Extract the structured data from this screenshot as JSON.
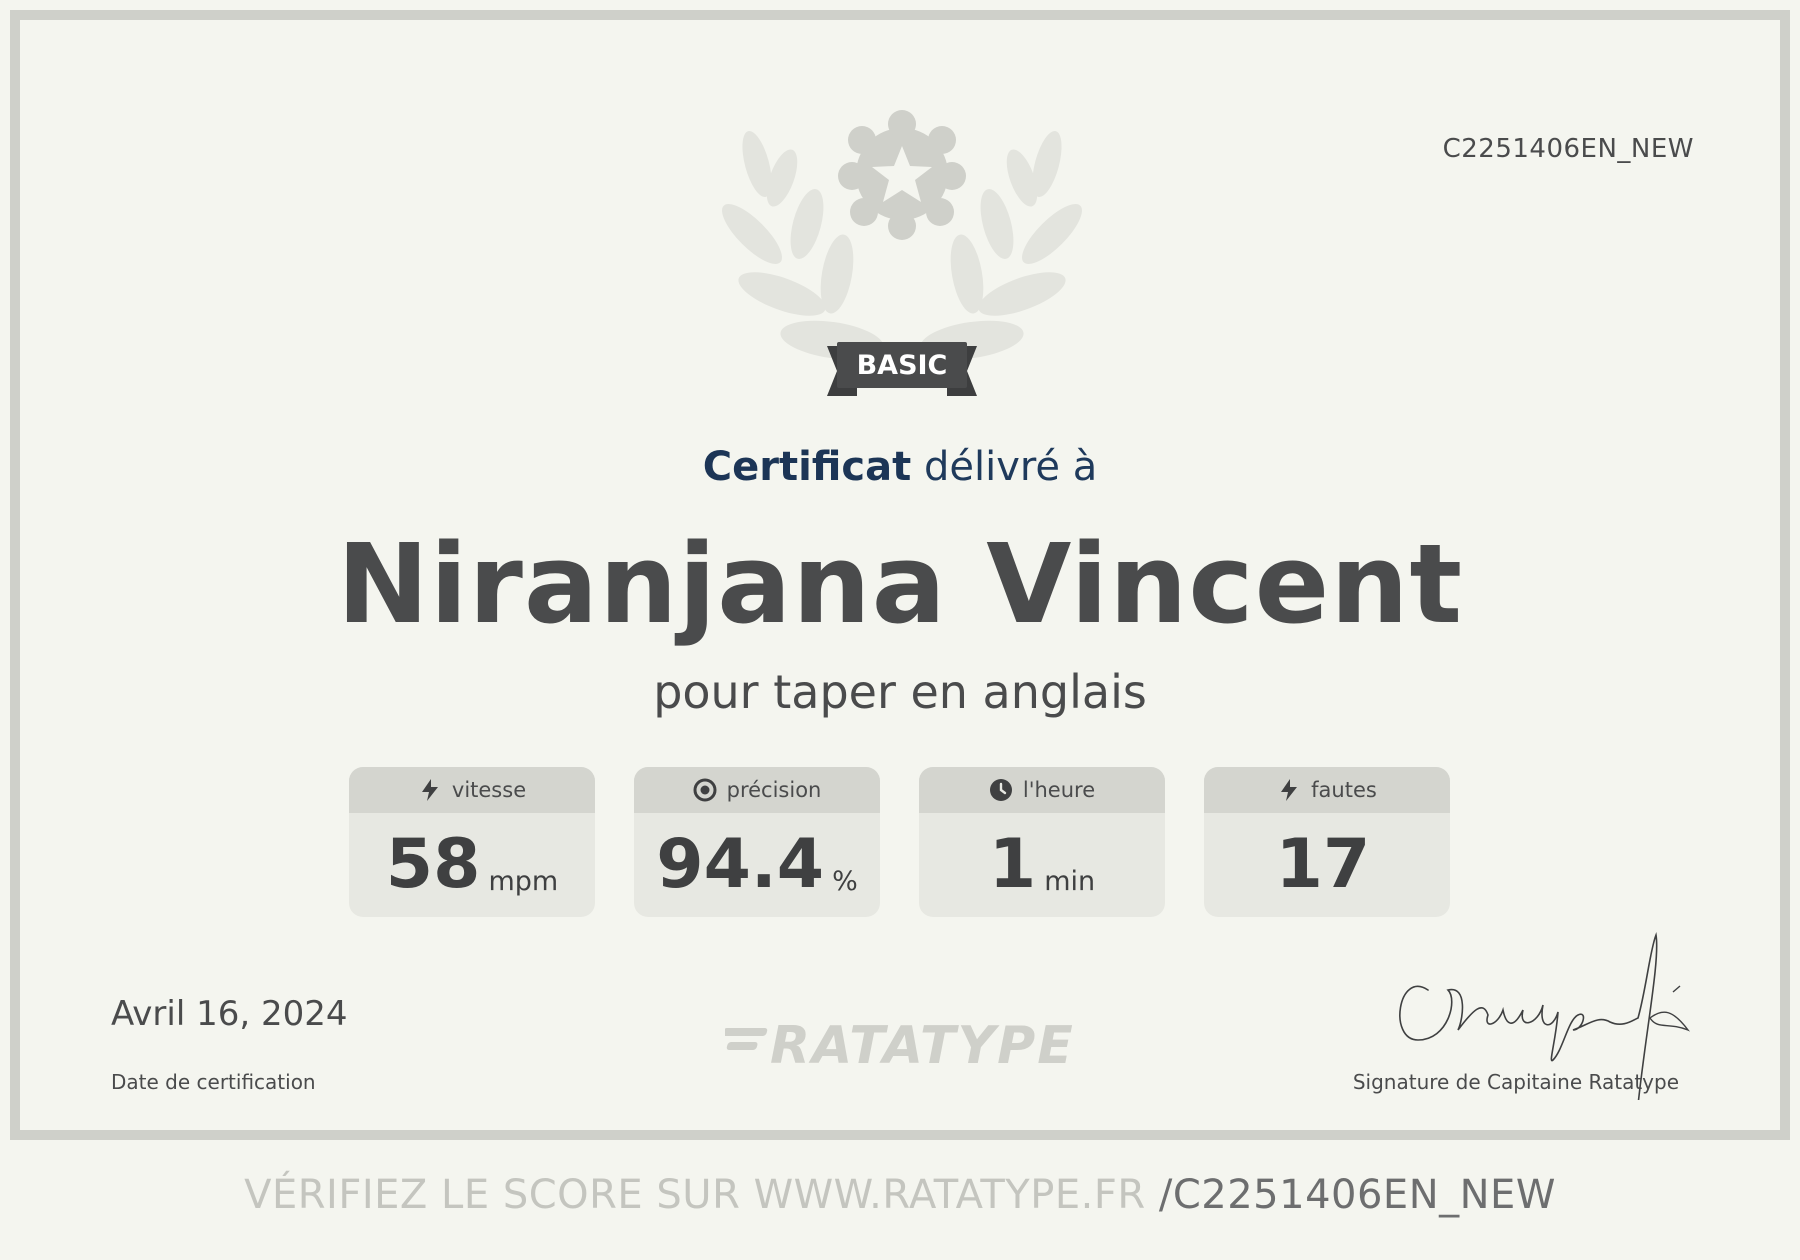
{
  "certificate": {
    "id": "C2251406EN_NEW",
    "level": "BASIC",
    "headline_bold": "Certificat",
    "headline_rest": " délivré à",
    "recipient": "Niranjana Vincent",
    "subtitle": "pour taper en anglais"
  },
  "stats": [
    {
      "label": "vitesse",
      "icon": "lightning-icon",
      "value": "58",
      "unit": "mpm"
    },
    {
      "label": "précision",
      "icon": "target-icon",
      "value": "94.4",
      "unit": "%"
    },
    {
      "label": "l'heure",
      "icon": "clock-icon",
      "value": "1",
      "unit": "min"
    },
    {
      "label": "fautes",
      "icon": "lightning-icon",
      "value": "17",
      "unit": ""
    }
  ],
  "footer": {
    "date": "Avril 16, 2024",
    "date_label": "Date de certification",
    "logo": "RATATYPE",
    "signature_label": "Signature de Capitaine Ratatype"
  },
  "verify": {
    "prefix": "VÉRIFIEZ LE SCORE SUR WWW.RATATYPE.FR ",
    "code": "/C2251406EN_NEW"
  },
  "colors": {
    "background": "#f4f5ef",
    "frame": "#cfd0ca",
    "headline": "#1c3556",
    "text": "#4a4b4c"
  }
}
